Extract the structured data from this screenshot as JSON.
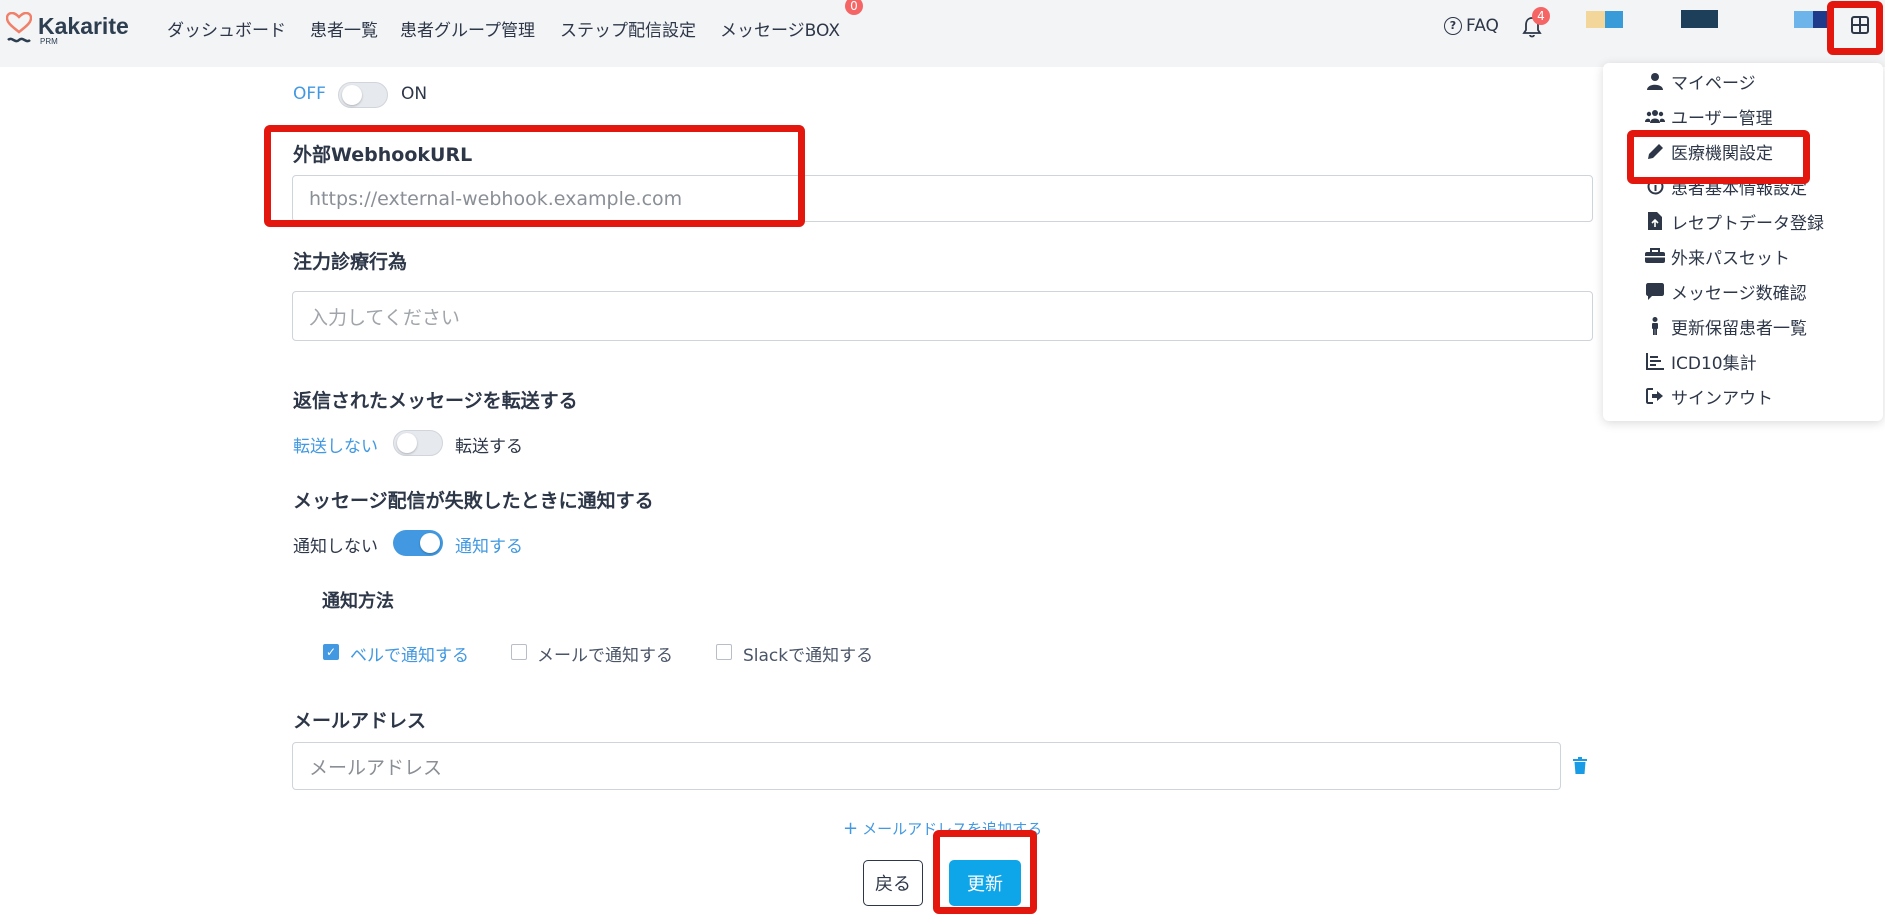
{
  "header": {
    "logo_text": "Kakarite",
    "logo_sub": "PRM",
    "nav": [
      "ダッシュボード",
      "患者一覧",
      "患者グループ管理",
      "ステップ配信設定",
      "メッセージBOX"
    ],
    "message_badge": "0",
    "faq_label": "FAQ",
    "notification_badge": "4",
    "apps_icon": "grid-icon"
  },
  "form": {
    "top_toggle": {
      "off_label": "OFF",
      "on_label": "ON",
      "state": "off"
    },
    "webhook": {
      "label": "外部WebhookURL",
      "placeholder": "https://external-webhook.example.com"
    },
    "focus_treatment": {
      "label": "注力診療行為",
      "placeholder": "入力してください"
    },
    "forward": {
      "label": "返信されたメッセージを転送する",
      "off_label": "転送しない",
      "on_label": "転送する",
      "state": "off"
    },
    "failure_notify": {
      "label": "メッセージ配信が失敗したときに通知する",
      "off_label": "通知しない",
      "on_label": "通知する",
      "state": "on"
    },
    "notify_method": {
      "label": "通知方法",
      "options": [
        {
          "label": "ベルで通知する",
          "checked": true
        },
        {
          "label": "メールで通知する",
          "checked": false
        },
        {
          "label": "Slackで通知する",
          "checked": false
        }
      ]
    },
    "email": {
      "label": "メールアドレス",
      "placeholder": "メールアドレス",
      "add_link": "メールアドレスを追加する"
    },
    "back_button": "戻る",
    "update_button": "更新"
  },
  "dropdown": {
    "items": [
      {
        "label": "マイページ",
        "icon": "user-icon"
      },
      {
        "label": "ユーザー管理",
        "icon": "users-icon"
      },
      {
        "label": "医療機関設定",
        "icon": "pencil-icon"
      },
      {
        "label": "患者基本情報設定",
        "icon": "info-icon"
      },
      {
        "label": "レセプトデータ登録",
        "icon": "file-icon"
      },
      {
        "label": "外来パスセット",
        "icon": "toolbox-icon"
      },
      {
        "label": "メッセージ数確認",
        "icon": "comment-icon"
      },
      {
        "label": "更新保留患者一覧",
        "icon": "person-icon"
      },
      {
        "label": "ICD10集計",
        "icon": "chart-icon"
      },
      {
        "label": "サインアウト",
        "icon": "signout-icon"
      }
    ]
  },
  "colors": {
    "accent": "#4299e1",
    "button": "#0ea5e9",
    "highlight": "#e3170d",
    "header_bg": "#f3f4f6"
  }
}
